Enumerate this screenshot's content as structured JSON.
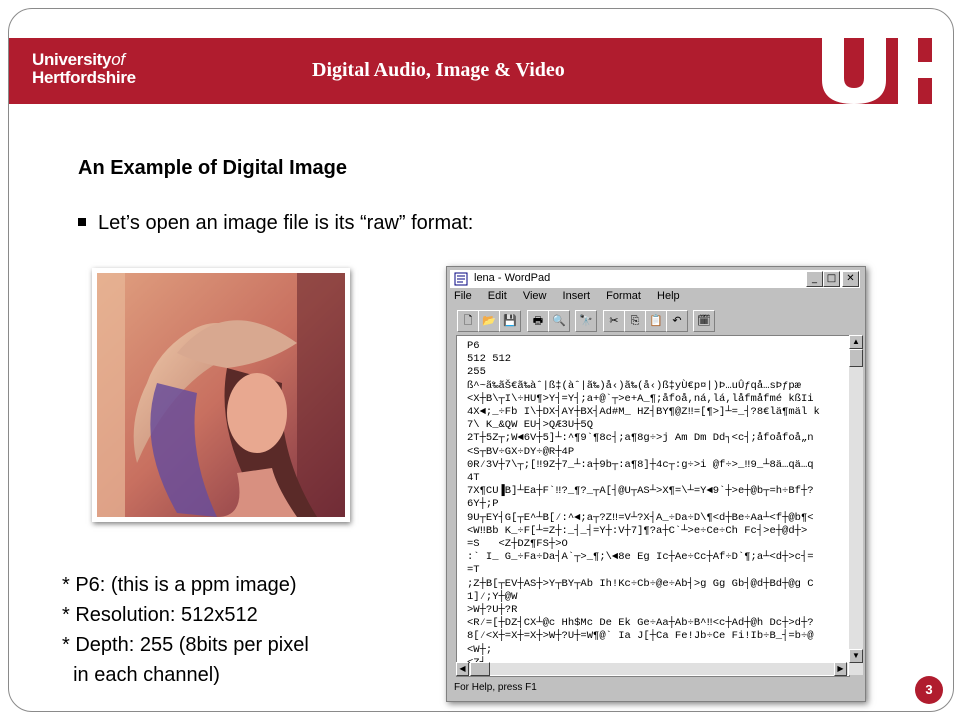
{
  "header": {
    "logo_line1": "University",
    "logo_of": "of",
    "logo_line2": "Hertfordshire",
    "course_title": "Digital Audio, Image & Video",
    "brand_color": "#b01c2e"
  },
  "slide": {
    "heading": "An Example of Digital Image",
    "bullet": "Let’s open an image file is its “raw” format:",
    "notes": [
      "* P6: (this is a ppm image)",
      "* Resolution: 512x512",
      "* Depth: 255 (8bits per pixel",
      "  in each channel)"
    ],
    "page_number": "3"
  },
  "wordpad": {
    "title": "lena - WordPad",
    "window_buttons": [
      "_",
      "□",
      "✕"
    ],
    "menu": [
      "File",
      "Edit",
      "View",
      "Insert",
      "Format",
      "Help"
    ],
    "toolbar_icons": [
      "new-icon",
      "open-icon",
      "save-icon",
      "print-icon",
      "print-preview-icon",
      "find-icon",
      "cut-icon",
      "copy-icon",
      "paste-icon",
      "undo-icon",
      "datetime-icon"
    ],
    "content": "P6\n512 512\n255\nß^~ã‰ãŠ€ã‰àˆ|ß‡(àˆ|ã‰)å‹)ã‰(å‹)ß‡yÙ€p¤|)Þ…uÛƒqå…sÞƒpæ\n<X┼B\\┬I\\÷HU¶>Y┤=Y┤;a+@`┬>e+A_¶;åfoå,ná,lá,låfmåfmé kßIi\n4X◄;_÷Fb I\\┼DX┤AY┼BX┤Ad#M_ HZ┤BY¶@Z‼=[¶>]┴=_┤?8€lä¶mäl k\n7\\ K_&QW EU┤>QÆ3U┼5Q\n2T┼5Z┬;W◄6V┼5]┴:^¶9`¶8c┤;a¶8g÷>j Am Dm Dd┐<c┤;åfoåfoå„n\n<S┬BV÷GX÷DY÷@R┼4P\n0R⁄3V┼7\\┬;[‼9Z┼7_┴:a┼9b┬:a¶8]┼4c┬:g÷>i @f÷>_‼9_┴8ä…qä…q\n4T\n7X¶CU▐B]┴Ea┼F`‼?_¶?_┬A[┤@U┬AS┴>X¶=\\┴=Y◄9`┼>e┼@b┬=h÷Bf┼?\n6Y┼;P\n9U┬EY┤G[┬E^┴B[⁄:^◄;a┬?Z‼=V┴?X┤A_÷Da÷D\\¶<d┼Be÷Aa┴<f┼@b¶<\n<W‼Bb K_÷F[┴=Z┼:_┤_┤=Y┼:V┼7]¶?a┼C`┴>e÷Ce÷Ch Fc┤>e┼@d┼>\n=S   <Z┼DZ¶FS┼>O\n:` I_ G_÷Fa÷Da┤A`┬>_¶;\\◄8e Eg Ic┼Ae÷Cc┼Af÷D`¶;a┴<d┼>c┤=\n=T\n;Z┼B[┬EV┼AS┼>Y┬BY┬Ab Ih!Kc÷Cb÷@e÷Ab┤>g Gg Gb┤@d┼Bd┼@g C\n1]⁄;Y┼@W\n>W┼?U┼?R\n<R⁄=[┼DZ┤CX┴@c Hh$Mc De Ek Ge÷Aa┼Ab÷B^‼<c┼Ad┼@h Dc┼>d┼?\n8[⁄<X┼=X┼=X┼>W┼?U┼=W¶@` Ia J[┼Ca Fe!Jb÷Ce Fi!Ib÷B_┤=b÷@\n<W┼;\n<Z┤",
    "status": "For Help, press F1"
  }
}
